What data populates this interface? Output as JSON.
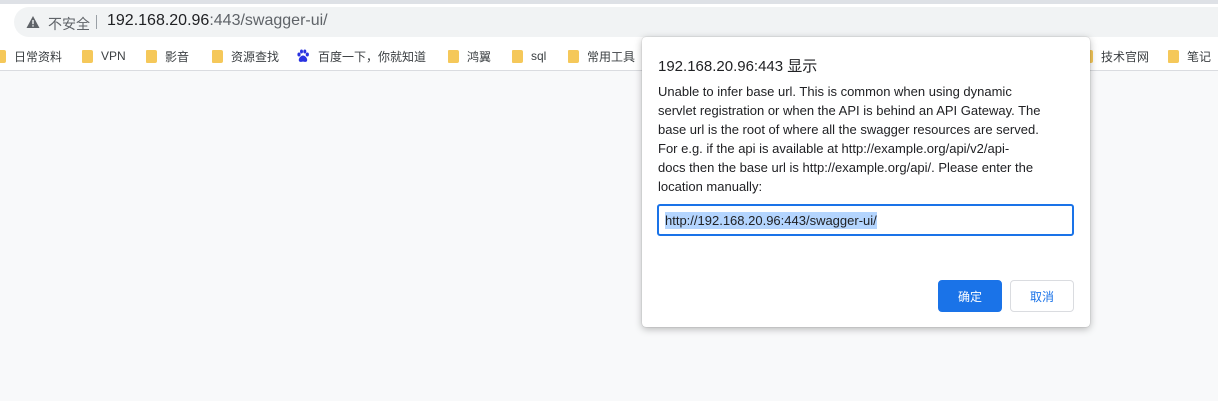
{
  "address_bar": {
    "security_label": "不安全",
    "url_host": "192.168.20.96",
    "url_path": ":443/swagger-ui/"
  },
  "bookmarks": [
    {
      "label": "日常资料",
      "icon": "folder-icon"
    },
    {
      "label": "VPN",
      "icon": "folder-icon"
    },
    {
      "label": "影音",
      "icon": "folder-icon"
    },
    {
      "label": "资源查找",
      "icon": "folder-icon"
    },
    {
      "label": "百度一下，你就知道",
      "icon": "baidu-paw-icon"
    },
    {
      "label": "鸿翼",
      "icon": "folder-icon"
    },
    {
      "label": "sql",
      "icon": "folder-icon"
    },
    {
      "label": "常用工具",
      "icon": "folder-icon"
    },
    {
      "label": "技术官网",
      "icon": "folder-icon"
    },
    {
      "label": "笔记",
      "icon": "folder-icon"
    }
  ],
  "dialog": {
    "title": "192.168.20.96:443 显示",
    "message": "Unable to infer base url. This is common when using dynamic\nservlet registration or when the API is behind an API Gateway. The\nbase url is the root of where all the swagger resources are served.\nFor e.g. if the api is available at http://example.org/api/v2/api-\ndocs then the base url is http://example.org/api/. Please enter the\nlocation manually:",
    "input_value": "http://192.168.20.96:443/swagger-ui/",
    "ok_label": "确定",
    "cancel_label": "取消"
  },
  "colors": {
    "accent": "#1a73e8",
    "folder": "#f5c85a",
    "selection": "#b4d5fe"
  }
}
